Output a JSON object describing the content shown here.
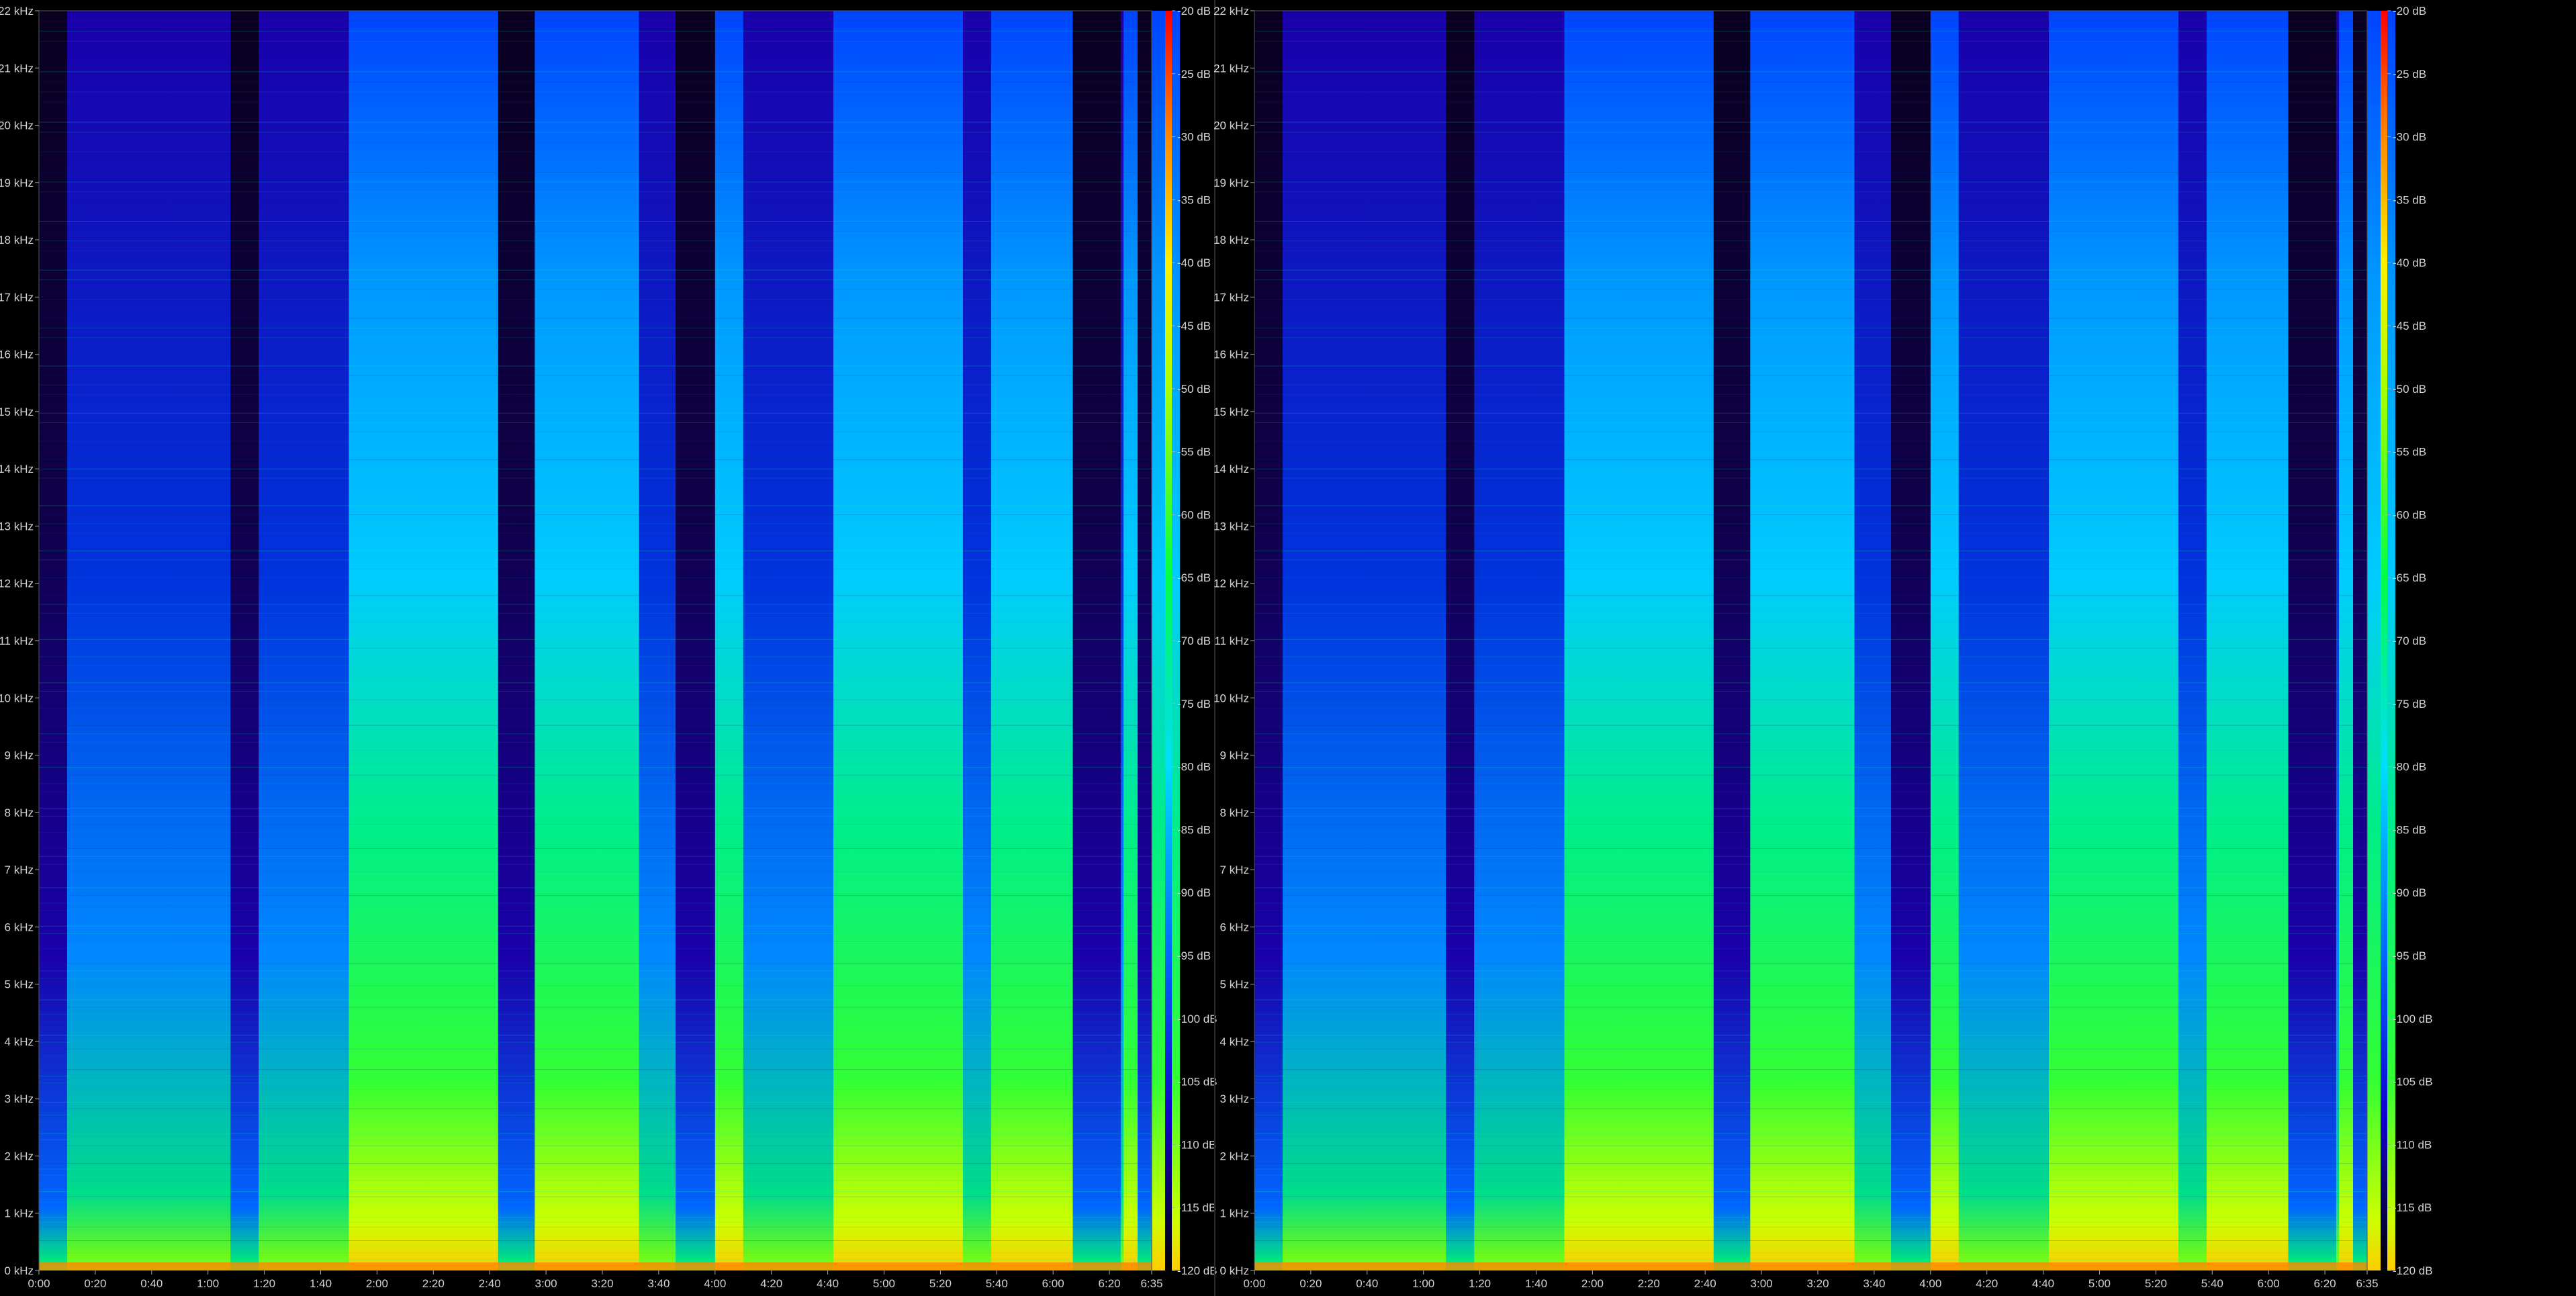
{
  "panels": [
    {
      "file_info": "",
      "chart": {
        "type": "heatmap",
        "subtype": "spectrogram",
        "x_ticks": [
          "0:00",
          "0:20",
          "0:40",
          "1:00",
          "1:20",
          "1:40",
          "2:00",
          "2:20",
          "2:40",
          "3:00",
          "3:20",
          "3:40",
          "4:00",
          "4:20",
          "4:40",
          "5:00",
          "5:20",
          "5:40",
          "6:00",
          "6:20",
          "6:35"
        ],
        "y_ticks": [
          "0 kHz",
          "1 kHz",
          "2 kHz",
          "3 kHz",
          "4 kHz",
          "5 kHz",
          "6 kHz",
          "7 kHz",
          "8 kHz",
          "9 kHz",
          "10 kHz",
          "11 kHz",
          "12 kHz",
          "13 kHz",
          "14 kHz",
          "15 kHz",
          "16 kHz",
          "17 kHz",
          "18 kHz",
          "19 kHz",
          "20 kHz",
          "21 kHz",
          "22 kHz"
        ],
        "db_ticks": [
          "-20 dB",
          "-25 dB",
          "-30 dB",
          "-35 dB",
          "-40 dB",
          "-45 dB",
          "-50 dB",
          "-55 dB",
          "-60 dB",
          "-65 dB",
          "-70 dB",
          "-75 dB",
          "-80 dB",
          "-85 dB",
          "-90 dB",
          "-95 dB",
          "-100 dB",
          "-105 dB",
          "-110 dB",
          "-115 dB",
          "-120 dB"
        ]
      }
    },
    {
      "file_info": "",
      "chart": {
        "type": "heatmap",
        "subtype": "spectrogram",
        "x_ticks": [
          "0:00",
          "0:20",
          "0:40",
          "1:00",
          "1:20",
          "1:40",
          "2:00",
          "2:20",
          "2:40",
          "3:00",
          "3:20",
          "3:40",
          "4:00",
          "4:20",
          "4:40",
          "5:00",
          "5:20",
          "5:40",
          "6:00",
          "6:20",
          "6:35"
        ],
        "y_ticks": [
          "0 kHz",
          "1 kHz",
          "2 kHz",
          "3 kHz",
          "4 kHz",
          "5 kHz",
          "6 kHz",
          "7 kHz",
          "8 kHz",
          "9 kHz",
          "10 kHz",
          "11 kHz",
          "12 kHz",
          "13 kHz",
          "14 kHz",
          "15 kHz",
          "16 kHz",
          "17 kHz",
          "18 kHz",
          "19 kHz",
          "20 kHz",
          "21 kHz",
          "22 kHz"
        ],
        "db_ticks": [
          "-20 dB",
          "-25 dB",
          "-30 dB",
          "-35 dB",
          "-40 dB",
          "-45 dB",
          "-50 dB",
          "-55 dB",
          "-60 dB",
          "-65 dB",
          "-70 dB",
          "-75 dB",
          "-80 dB",
          "-85 dB",
          "-90 dB",
          "-95 dB",
          "-100 dB",
          "-105 dB",
          "-110 dB",
          "-115 dB",
          "-120 dB"
        ]
      }
    }
  ],
  "chart_data": [
    {
      "type": "heatmap",
      "title": "",
      "xlabel": "",
      "ylabel": "",
      "xlim": [
        "0:00",
        "6:35"
      ],
      "ylim_khz": [
        0,
        22
      ],
      "color_range_db": [
        -120,
        -20
      ],
      "colormap": [
        "#000000",
        "#0000ff",
        "#00aaff",
        "#00ff88",
        "#aaff00",
        "#ffcc00",
        "#ff0000"
      ],
      "loud_segments_seconds": [
        [
          110,
          213
        ],
        [
          235,
          250
        ],
        [
          282,
          328
        ],
        [
          338,
          368
        ],
        [
          385,
          405
        ]
      ],
      "quiet_segments_seconds": [
        [
          0,
          10
        ],
        [
          68,
          78
        ],
        [
          163,
          176
        ],
        [
          226,
          240
        ],
        [
          367,
          384
        ],
        [
          390,
          395
        ]
      ]
    },
    {
      "type": "heatmap",
      "title": "",
      "xlabel": "",
      "ylabel": "",
      "xlim": [
        "0:00",
        "6:35"
      ],
      "ylim_khz": [
        0,
        22
      ],
      "color_range_db": [
        -120,
        -20
      ],
      "colormap": [
        "#000000",
        "#0000ff",
        "#00aaff",
        "#00ff88",
        "#aaff00",
        "#ffcc00",
        "#ff0000"
      ],
      "loud_segments_seconds": [
        [
          110,
          213
        ],
        [
          235,
          250
        ],
        [
          282,
          328
        ],
        [
          338,
          368
        ],
        [
          385,
          405
        ]
      ],
      "quiet_segments_seconds": [
        [
          0,
          10
        ],
        [
          68,
          78
        ],
        [
          163,
          176
        ],
        [
          226,
          240
        ],
        [
          367,
          384
        ],
        [
          390,
          395
        ]
      ]
    }
  ]
}
